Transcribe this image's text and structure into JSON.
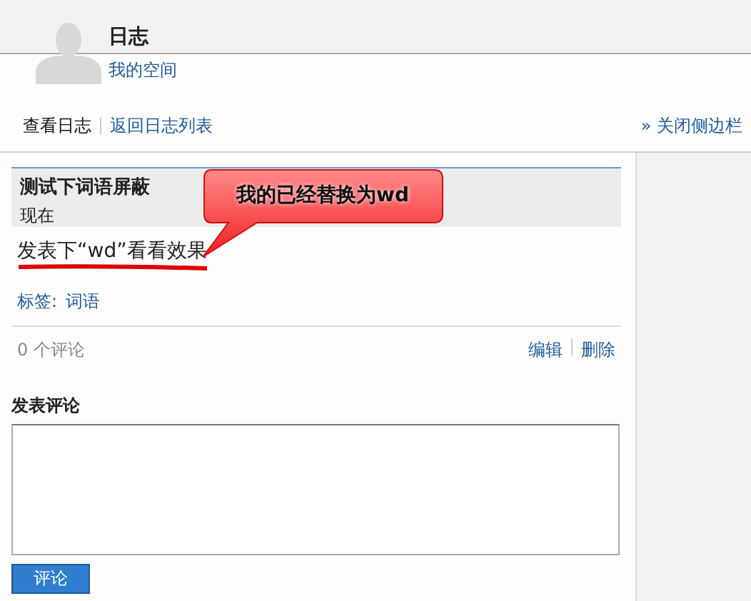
{
  "header": {
    "title": "日志",
    "space_link": "我的空间"
  },
  "tabs": [
    {
      "label": "查看日志",
      "selected": true
    },
    {
      "label": "返回日志列表",
      "selected": false
    }
  ],
  "close_sidebar": "» 关闭侧边栏",
  "post": {
    "title": "测试下词语屏蔽",
    "time": "现在",
    "body": "发表下“wd”看看效果",
    "tags_label": "标签:",
    "tag": "词语",
    "comment_count": "0 个评论",
    "actions": [
      "编辑",
      "删除"
    ]
  },
  "callout": "我的已经替换为wd",
  "comment_form": {
    "heading": "发表评论",
    "button": "评论"
  }
}
